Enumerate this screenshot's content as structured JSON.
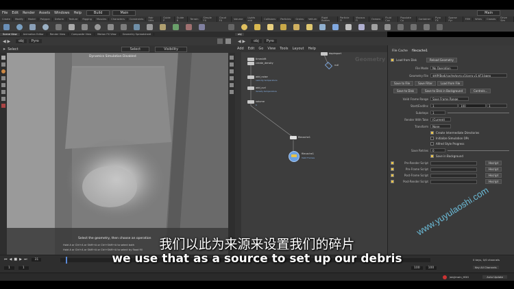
{
  "menubar": {
    "items": [
      "File",
      "Edit",
      "Render",
      "Assets",
      "Windows",
      "Help"
    ],
    "desktop": "Build",
    "view": "Main",
    "right_desktop": "Main"
  },
  "shelf_tabs": [
    "Create",
    "Modify",
    "Model",
    "Polygon",
    "Deform",
    "Texture",
    "Rigging",
    "Muscles",
    "Characters",
    "Constraints",
    "Hair Utils",
    "Guide P",
    "Guide B",
    "Terrain",
    "Simple FX",
    "Cloud FX",
    "Volume",
    "Lights and",
    "Collisions",
    "Particles",
    "Grains",
    "Vellum",
    "Rigid Bodies",
    "Particle Fl",
    "Viscous Fl",
    "Oceans",
    "Fluid Con",
    "Populate Co",
    "Container",
    "Pyro FX",
    "Sparse Pyr",
    "FEM",
    "Wires",
    "Crowds",
    "Drive Sim"
  ],
  "viewport": {
    "tabs": [
      "Scene View",
      "Animation Editor",
      "Render View",
      "Composite View",
      "Motion FX View",
      "Geometry Spreadsheet"
    ],
    "path": [
      "obj",
      "Pyro"
    ],
    "tool_label": "Select",
    "select_mode": "Select",
    "visibility": "Visibility",
    "overlay": "Dynamics Simulation Disabled",
    "status_title": "Select the geometry, then choose an operation",
    "status_hint1": "Hold A or Ctrl+A or Shift+A or Ctrl+Shift+A to select both",
    "status_hint2": "Hold A or Ctrl+A or Shift+A or Ctrl+Shift+A to select by flood fill"
  },
  "network": {
    "path": [
      "obj",
      "Pyro"
    ],
    "menu": [
      "Add",
      "Edit",
      "Go",
      "View",
      "Tools",
      "Layout",
      "Help"
    ],
    "context_label": "Geometry",
    "nodes": [
      {
        "name": "timeshift",
        "sub": ""
      },
      {
        "name": "create_density",
        "sub": ""
      },
      {
        "name": "add_noise",
        "sub": "velocity temperature"
      },
      {
        "name": "add_curl",
        "sub": "density temperature"
      },
      {
        "name": "volume",
        "sub": "b"
      },
      {
        "name": "filecache1",
        "sub": ""
      },
      {
        "name": "dopimport",
        "sub": ""
      },
      {
        "name": "null",
        "sub": ""
      },
      {
        "name": "filecache1",
        "sub": ""
      },
      {
        "name": "filecache1",
        "sub": "Valid Frames"
      }
    ]
  },
  "params": {
    "node_type": "File Cache",
    "node_name": "filecache1",
    "load_from_disk": "Load from Disk",
    "reload_geometry": "Reload Geometry",
    "file_mode_label": "File Mode",
    "file_mode": "No Operation",
    "geometry_file_label": "Geometry File",
    "geometry_file": "$HIP/Bodi/cache/pyro.v1/pyro.v1.$F3.bgeo",
    "save_to_file": "Save to File",
    "save_filter": "Save Filter",
    "load_from_file": "Load from File",
    "save_to_disk": "Save to Disk",
    "save_bg": "Save to Disk in Background",
    "controls": "Controls...",
    "valid_range_label": "Valid Frame Range",
    "valid_range": "Save Frame Range",
    "start_end_label": "Start/End/Inc",
    "start": "1",
    "end": "100",
    "inc": "1",
    "substeps_label": "Substeps",
    "substeps": "1",
    "render_take_label": "Render With Take",
    "render_take": "(Current)",
    "transform_label": "Transform",
    "transform": "None",
    "chk1": "Create Intermediate Directories",
    "chk2": "Initialize Simulation OPs",
    "chk3": "Alfred Style Progress",
    "save_retries_label": "Save Retries",
    "save_retries": "0",
    "chk4": "Save in Background",
    "scripts": [
      "Pre-Render Script",
      "Pre-Frame Script",
      "Post-Frame Script",
      "Post-Render Script"
    ],
    "hscript": "Hscript"
  },
  "timeline": {
    "frame": "31",
    "start": "1",
    "start2": "1",
    "end": "100",
    "end2": "100",
    "keys_info": "0 keys, 0/0 channels",
    "key_all": "Key All Channels",
    "auto_update": "Auto Update",
    "path": "/obj/main_HDG"
  },
  "subtitles": {
    "cn": "我们以此为来源来设置我们的碎片",
    "en": "we use that as a source to set up our debris"
  },
  "watermark": "www.yuyulaoshi.com",
  "colors": {
    "accent": "#e8c34a",
    "node_blue": "#6a9fe0"
  }
}
